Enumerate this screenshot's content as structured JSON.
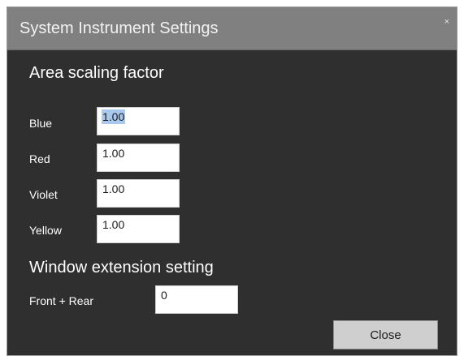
{
  "dialog": {
    "title": "System Instrument Settings",
    "close_icon_glyph": "×"
  },
  "area_scaling": {
    "heading": "Area scaling factor",
    "fields": [
      {
        "label": "Blue",
        "value": "1.00",
        "selected": true
      },
      {
        "label": "Red",
        "value": "1.00"
      },
      {
        "label": "Violet",
        "value": "1.00"
      },
      {
        "label": "Yellow",
        "value": "1.00"
      }
    ]
  },
  "window_extension": {
    "heading": "Window extension setting",
    "field": {
      "label": "Front + Rear",
      "value": "0"
    }
  },
  "buttons": {
    "close_label": "Close"
  },
  "colors": {
    "dialog_background": "#2f2f2f",
    "titlebar_background": "#808080",
    "selection_highlight": "#a8c8ee"
  }
}
